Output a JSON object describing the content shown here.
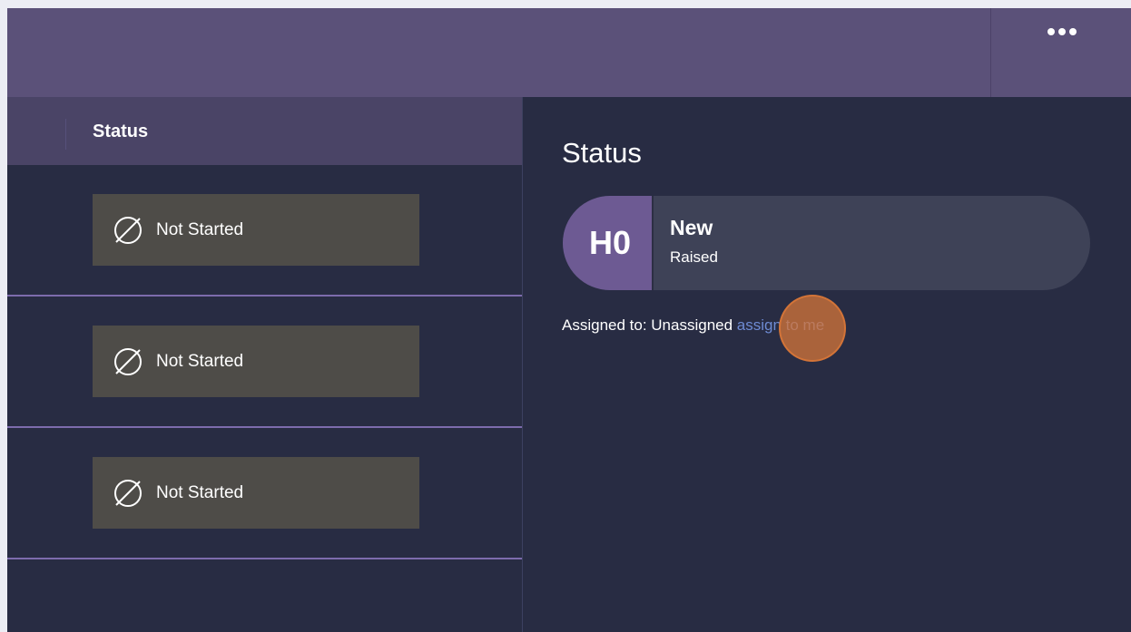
{
  "topbar": {
    "more_icon": "ellipsis-icon"
  },
  "table": {
    "column_header": "Status",
    "rows": [
      {
        "status_label": "Not Started",
        "icon": "empty-set-icon"
      },
      {
        "status_label": "Not Started",
        "icon": "empty-set-icon"
      },
      {
        "status_label": "Not Started",
        "icon": "empty-set-icon"
      }
    ]
  },
  "detail": {
    "title": "Status",
    "badge_code": "H0",
    "status_name": "New",
    "status_sub": "Raised",
    "assigned_prefix": "Assigned to: Unassigned ",
    "assign_link": "assign to me"
  },
  "colors": {
    "topbar": "#5b5179",
    "background": "#282c43",
    "header": "#4a4466",
    "chip": "#4e4c48",
    "badge": "#6d5a93",
    "link": "#6e8bd3",
    "click_indicator": "#d67638"
  }
}
